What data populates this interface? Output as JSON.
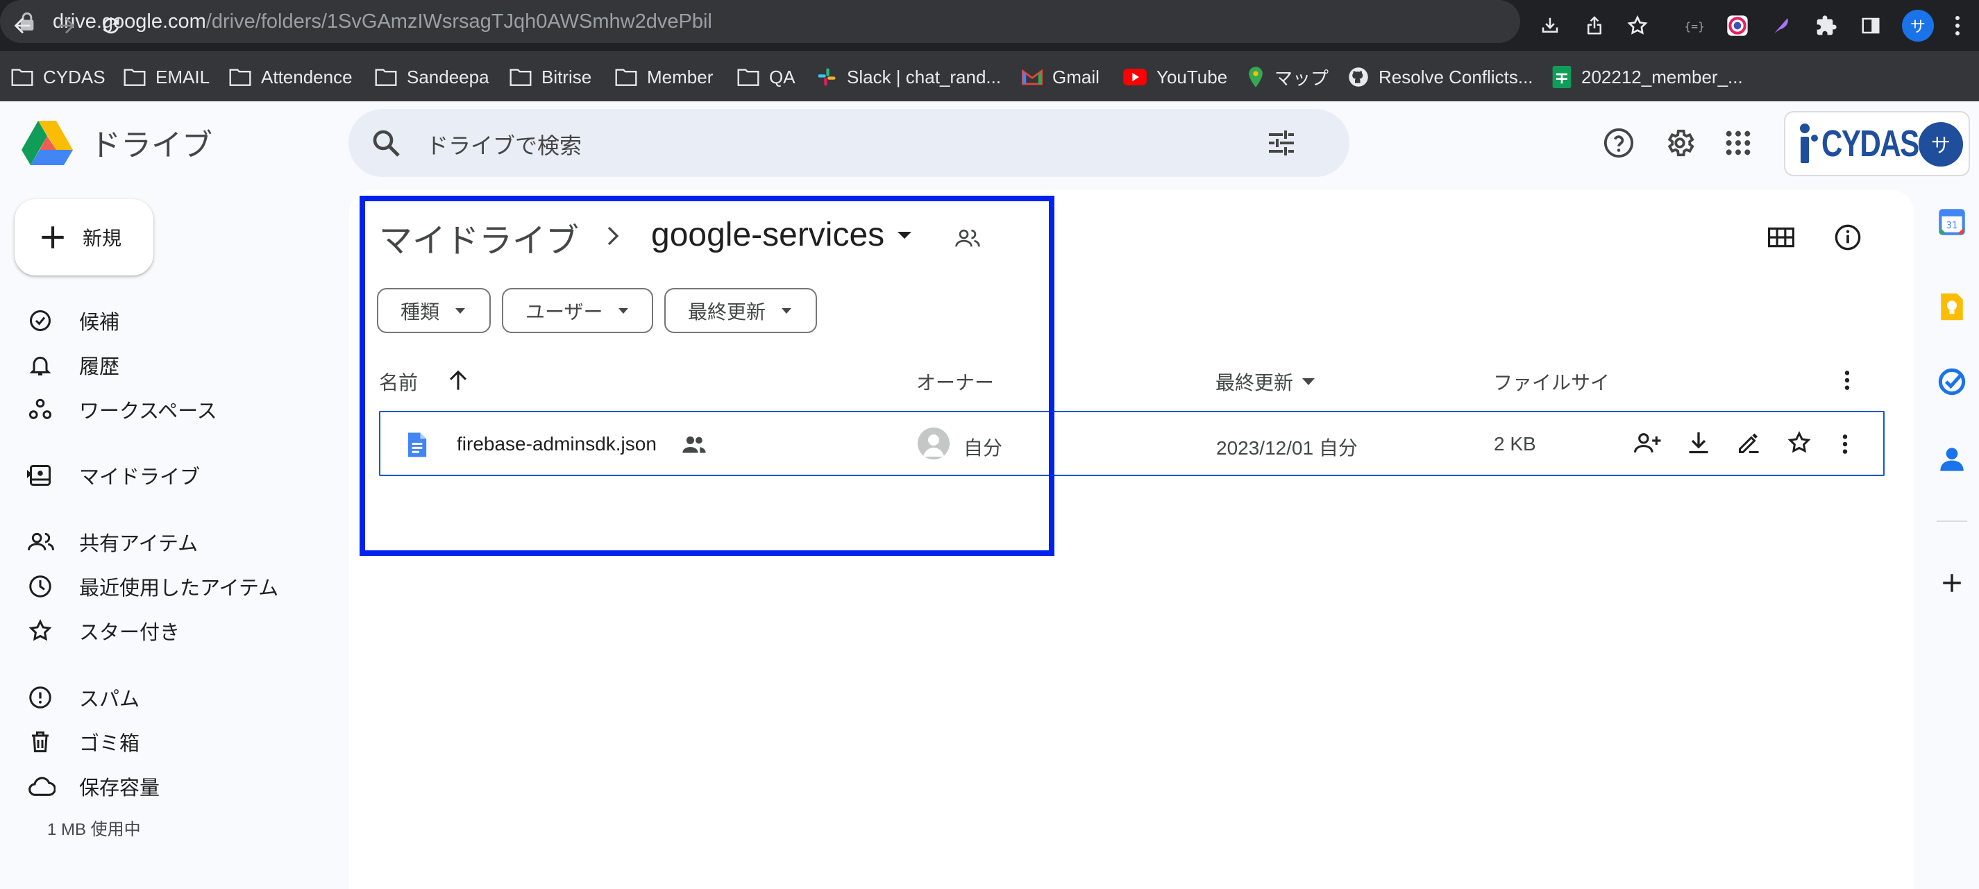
{
  "browser": {
    "url_host": "drive.google.com",
    "url_path": "/drive/folders/1SvGAmzIWsrsagTJqh0AWSmhw2dvePbil",
    "profile_initial": "サ",
    "bookmarks": [
      "CYDAS",
      "EMAIL",
      "Attendence",
      "Sandeepa",
      "Bitrise",
      "Member",
      "QA",
      "Slack | chat_rand...",
      "Gmail",
      "YouTube",
      "マップ",
      "Resolve Conflicts...",
      "202212_member_..."
    ]
  },
  "drive": {
    "brand": "ドライブ",
    "search_placeholder": "ドライブで検索",
    "account_logo": "CYDAS",
    "account_initial": "サ",
    "new_label": "新規",
    "nav": [
      "候補",
      "履歴",
      "ワークスペース",
      "マイドライブ",
      "共有アイテム",
      "最近使用したアイテム",
      "スター付き",
      "スパム",
      "ゴミ箱",
      "保存容量"
    ],
    "storage_text": "1 MB 使用中"
  },
  "content": {
    "breadcrumb_root": "マイドライブ",
    "breadcrumb_current": "google-services",
    "filters": [
      "種類",
      "ユーザー",
      "最終更新"
    ],
    "columns": {
      "name": "名前",
      "owner": "オーナー",
      "modified": "最終更新",
      "size": "ファイルサイ"
    },
    "file": {
      "name": "firebase-adminsdk.json",
      "owner": "自分",
      "modified": "2023/12/01 自分",
      "size": "2 KB"
    }
  },
  "side_panel": {
    "calendar_day": "31"
  },
  "colors": {
    "accent": "#0b57d0",
    "highlight": "#0022ee"
  },
  "icons": [
    "back-icon",
    "forward-icon",
    "reload-icon",
    "lock-icon",
    "search-icon",
    "tune-icon",
    "help-icon",
    "settings-icon",
    "apps-icon",
    "plus-icon",
    "grid-view-icon",
    "info-icon",
    "doc-icon",
    "shared-icon",
    "share-icon",
    "download-icon",
    "rename-icon",
    "star-icon",
    "more-icon"
  ]
}
